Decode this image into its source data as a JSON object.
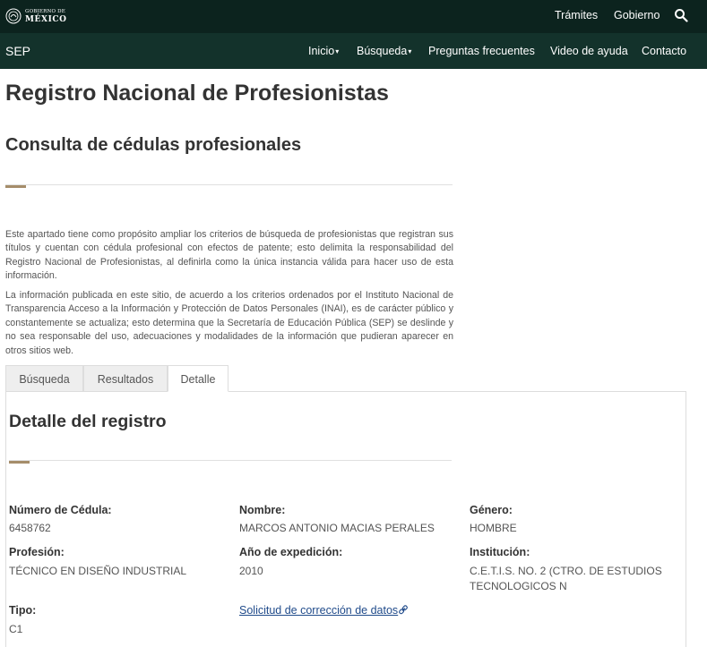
{
  "topbar": {
    "logo_line1": "GOBIERNO DE",
    "logo_line2": "MÉXICO",
    "links": [
      "Trámites",
      "Gobierno"
    ],
    "search_icon": "search-icon"
  },
  "navbar": {
    "brand": "SEP",
    "items": [
      "Inicio",
      "Búsqueda",
      "Preguntas frecuentes",
      "Video de ayuda",
      "Contacto"
    ]
  },
  "page": {
    "title": "Registro Nacional de Profesionistas",
    "subtitle": "Consulta de cédulas profesionales",
    "paragraph1": "Este apartado tiene como propósito ampliar los criterios de búsqueda de profesionistas que registran sus títulos y cuentan con cédula profesional con efectos de patente; esto delimita la responsabilidad del Registro Nacional de Profesionistas, al definirla como la única instancia válida para hacer uso de esta información.",
    "paragraph2": "La información publicada en este sitio, de acuerdo a los criterios ordenados por el Instituto Nacional de Transparencia  Acceso a la Información y Protección de Datos Personales (INAI), es de carácter público y constantemente se actualiza; esto determina que la Secretaría de Educación Pública (SEP) se deslinde y no sea responsable del uso, adecuaciones y modalidades de la información que pudieran aparecer en otros sitios web."
  },
  "tabs": [
    {
      "label": "Búsqueda",
      "active": false
    },
    {
      "label": "Resultados",
      "active": false
    },
    {
      "label": "Detalle",
      "active": true
    }
  ],
  "detail": {
    "title": "Detalle del registro",
    "cedula_label": "Número de Cédula:",
    "cedula_value": "6458762",
    "nombre_label": "Nombre:",
    "nombre_value": "MARCOS ANTONIO MACIAS PERALES",
    "genero_label": "Género:",
    "genero_value": "HOMBRE",
    "profesion_label": "Profesión:",
    "profesion_value": "TÉCNICO EN DISEÑO INDUSTRIAL",
    "anio_label": "Año de expedición:",
    "anio_value": "2010",
    "institucion_label": "Institución:",
    "institucion_value": "C.E.T.I.S. NO. 2 (CTRO. DE ESTUDIOS TECNOLOGICOS N",
    "tipo_label": "Tipo:",
    "tipo_value": "C1",
    "correction_link": "Solicitud de corrección de datos"
  },
  "colors": {
    "topbar": "#0c231e",
    "navbar": "#13322b",
    "accent": "#a58d6a",
    "link": "#1f4a8a"
  }
}
